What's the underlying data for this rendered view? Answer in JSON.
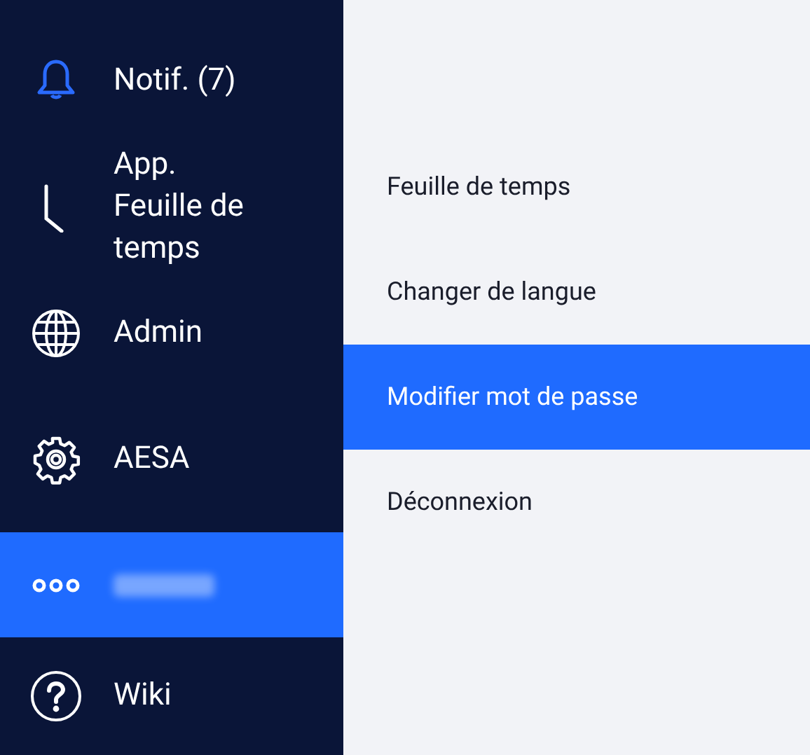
{
  "sidebar": {
    "items": [
      {
        "kind": "bell",
        "label": "Notif. (7)",
        "selected": false
      },
      {
        "kind": "clock",
        "label": "App.\nFeuille de\ntemps",
        "selected": false
      },
      {
        "kind": "globe",
        "label": "Admin",
        "selected": false
      },
      {
        "kind": "gear",
        "label": "AESA",
        "selected": false
      },
      {
        "kind": "dots",
        "redacted": true,
        "selected": true
      },
      {
        "kind": "help",
        "label": "Wiki",
        "selected": false
      }
    ]
  },
  "submenu": {
    "items": [
      {
        "label": "Feuille de temps",
        "selected": false
      },
      {
        "label": "Changer de langue",
        "selected": false
      },
      {
        "label": "Modifier mot de passe",
        "selected": true
      },
      {
        "label": "Déconnexion",
        "selected": false
      }
    ]
  }
}
